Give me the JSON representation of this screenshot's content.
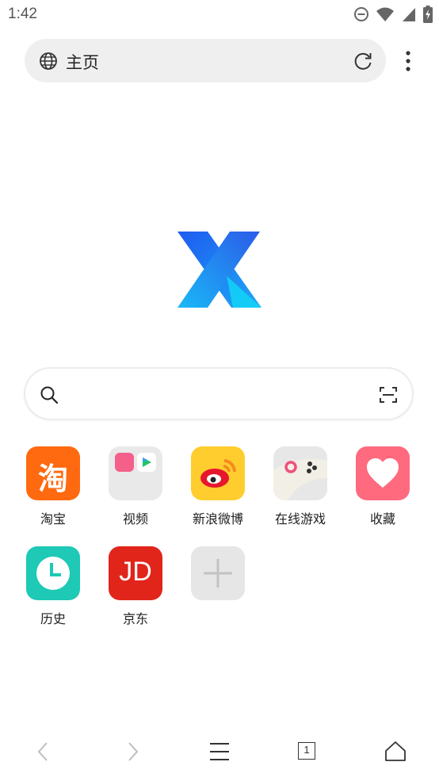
{
  "status_bar": {
    "time": "1:42"
  },
  "address_bar": {
    "title": "主页"
  },
  "search": {
    "placeholder": ""
  },
  "shortcuts": [
    {
      "label": "淘宝",
      "icon": "taobao-icon",
      "glyph": "淘",
      "color": "#ff6a10"
    },
    {
      "label": "视频",
      "icon": "video-folder-icon"
    },
    {
      "label": "新浪微博",
      "icon": "weibo-icon",
      "color": "#ffcd2e"
    },
    {
      "label": "在线游戏",
      "icon": "online-games-icon"
    },
    {
      "label": "收藏",
      "icon": "favorites-heart-icon",
      "color": "#ff6a7f"
    },
    {
      "label": "历史",
      "icon": "history-clock-icon",
      "color": "#1ec9b5"
    },
    {
      "label": "京东",
      "icon": "jd-icon",
      "glyph": "JD",
      "color": "#e1251b"
    },
    {
      "label": "",
      "icon": "add-shortcut-icon"
    }
  ],
  "bottom_nav": {
    "tab_count": "1"
  }
}
